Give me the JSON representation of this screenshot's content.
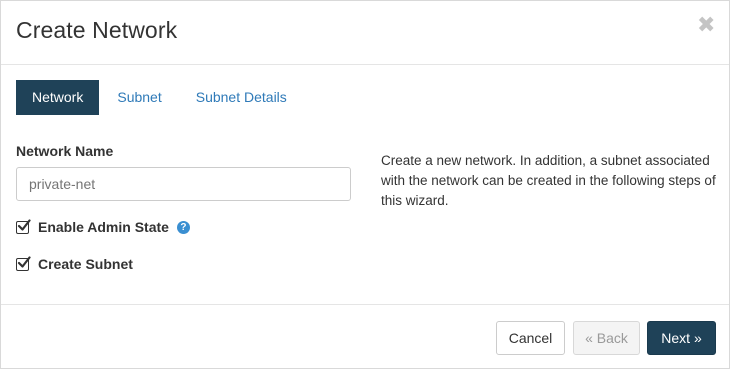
{
  "dialog": {
    "title": "Create Network",
    "close_symbol": "✖"
  },
  "tabs": [
    {
      "label": "Network",
      "active": true
    },
    {
      "label": "Subnet",
      "active": false
    },
    {
      "label": "Subnet Details",
      "active": false
    }
  ],
  "form": {
    "network_name_label": "Network Name",
    "network_name_value": "",
    "network_name_placeholder": "private-net",
    "enable_admin_state_label": "Enable Admin State",
    "enable_admin_state_checked": true,
    "help_symbol": "?",
    "create_subnet_label": "Create Subnet",
    "create_subnet_checked": true
  },
  "help_text": "Create a new network. In addition, a subnet associated with the network can be created in the following steps of this wizard.",
  "footer": {
    "cancel_label": "Cancel",
    "back_label": "« Back",
    "next_label": "Next »"
  },
  "colors": {
    "primary": "#1f4258",
    "link": "#2f7ab8",
    "help_icon": "#3a8fd1"
  },
  "icons": {
    "close": "close-icon",
    "checkbox": "checkbox-checked-icon",
    "help": "question-circle-icon"
  }
}
